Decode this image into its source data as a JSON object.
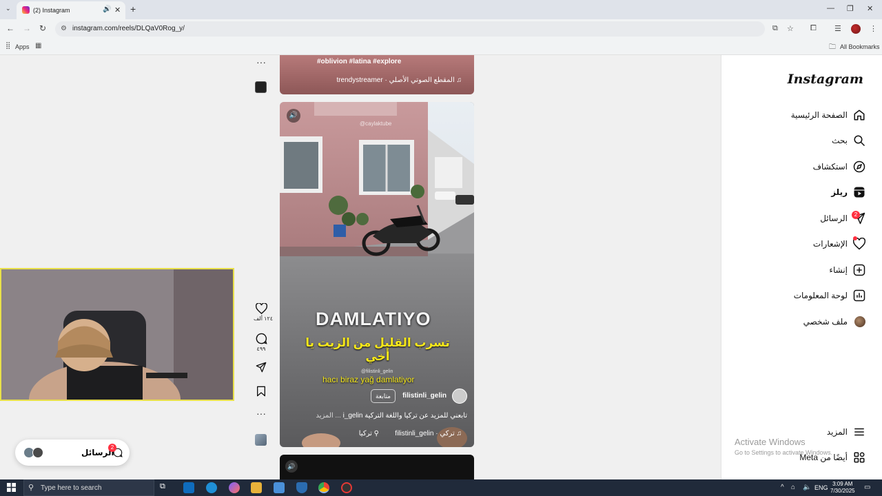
{
  "browser": {
    "tab_title": "(2) Instagram",
    "new_tab": "+",
    "url_site_icon": "⚙",
    "url": "instagram.com/reels/DLQaV0Rog_y/",
    "bookmarks": {
      "apps": "Apps",
      "all_bookmarks": "All Bookmarks"
    }
  },
  "reels": {
    "top": {
      "hashtags": "#oblivion #latina #explore",
      "audio": "♫ المقطع الصوتي الأصلي · trendystreamer"
    },
    "main": {
      "watermark": "@caylaktube",
      "overlay_title": "DAMLATIYO",
      "arabic_caption": "تسرب القليل من الزيت يا أخي",
      "handle_small": "@filistinli_gelin",
      "turkish_caption": "hacı biraz yağ damlatiyor",
      "username": "filistinli_gelin",
      "follow_label": "متابعة",
      "caption_text": "تابعني للمزيد عن تركيا واللغة التركية i_gelin",
      "caption_more": "... المزيد",
      "audio_line": "♫ تركي · filistinli_gelin",
      "location": "تركيا"
    },
    "actions": {
      "more": "···",
      "likes": "١٢٤ ألف",
      "comments": "٤٩٩"
    }
  },
  "nav": {
    "logo": "Instagram",
    "items": [
      {
        "label": "الصفحة الرئيسية",
        "icon": "home-icon"
      },
      {
        "label": "بحث",
        "icon": "search-icon"
      },
      {
        "label": "استكشاف",
        "icon": "compass-icon"
      },
      {
        "label": "ريلز",
        "icon": "reels-icon"
      },
      {
        "label": "الرسائل",
        "icon": "messenger-icon",
        "badge": "2"
      },
      {
        "label": "الإشعارات",
        "icon": "heart-icon"
      },
      {
        "label": "إنشاء",
        "icon": "plus-square-icon"
      },
      {
        "label": "لوحة المعلومات",
        "icon": "dashboard-icon"
      },
      {
        "label": "ملف شخصي",
        "icon": "profile-avatar"
      }
    ],
    "more": "المزيد",
    "meta": "أيضًا من Meta"
  },
  "messages_pill": {
    "label": "الرسائل",
    "badge": "2"
  },
  "windows": {
    "activate_title": "Activate Windows",
    "activate_sub": "Go to Settings to activate Windows.",
    "search_placeholder": "Type here to search",
    "lang": "ENG",
    "time": "3:09 AM",
    "date": "7/30/2025"
  },
  "colors": {
    "accent_red": "#ff3040",
    "caption_yellow": "#f5e71a",
    "webcam_border": "#e8e04a"
  }
}
